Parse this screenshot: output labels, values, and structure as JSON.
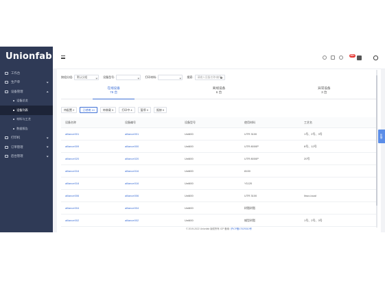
{
  "brand": {
    "logo_text": "Unionfab"
  },
  "sidebar": {
    "items": [
      {
        "label": "工作台"
      },
      {
        "label": "生产单"
      },
      {
        "label": "设备管理"
      },
      {
        "label": "设备总览"
      },
      {
        "label": "设备列表"
      },
      {
        "label": "材料与工艺"
      },
      {
        "label": "数据报告"
      },
      {
        "label": "打印机"
      },
      {
        "label": "订单管理"
      },
      {
        "label": "后台管理"
      }
    ]
  },
  "header": {
    "badge": "99+"
  },
  "filters": {
    "group_label": "按组分组:",
    "group_value": "默认分组",
    "model_label": "设备型号:",
    "material_label": "打印材料:",
    "search_label": "搜索:",
    "search_placeholder": "请输入设备名称/编号"
  },
  "stats": [
    {
      "label": "在线设备",
      "value": "78 台"
    },
    {
      "label": "离线设备",
      "value": "6 台"
    },
    {
      "label": "异常设备",
      "value": "3 台"
    }
  ],
  "tabs": [
    {
      "label": "待配置 2"
    },
    {
      "label": "已就绪 10"
    },
    {
      "label": "待装载 3"
    },
    {
      "label": "打印中 4"
    },
    {
      "label": "暂停 0"
    },
    {
      "label": "报修 0"
    }
  ],
  "table": {
    "columns": [
      "设备名称",
      "设备编号",
      "设备型号",
      "使用材料",
      "工艺名"
    ],
    "rows": [
      [
        "alliance001",
        "alliance001",
        "Uni600",
        "UTR 3100",
        "1号、2号、3号"
      ],
      [
        "alliance009",
        "alliance000",
        "Uni600",
        "UTR 8000P",
        "8号、12号"
      ],
      [
        "alliance020",
        "alliance020",
        "Uni600",
        "UTR 8000P",
        "20号"
      ],
      [
        "alliance016",
        "alliance016",
        "Uni600",
        "8100",
        ""
      ],
      [
        "alliance016",
        "alliance016",
        "Uni600",
        "Y1120",
        ""
      ],
      [
        "alliance006",
        "alliance006",
        "Uni600",
        "UTR 3100",
        "linux-local"
      ],
      [
        "alliance004",
        "alliance004",
        "Uni600",
        "树脂树脂",
        ""
      ],
      [
        "alliance002",
        "alliance002",
        "Uni600",
        "蜡型树脂",
        "1号、2号、3号"
      ]
    ]
  },
  "side_tab": {
    "label": "反馈"
  },
  "footer": {
    "copyright": "© 2019-2022 Unionfab 版权所有",
    "icp_label": "ICP 备案:",
    "icp_link": "沪ICP备17029310号"
  }
}
